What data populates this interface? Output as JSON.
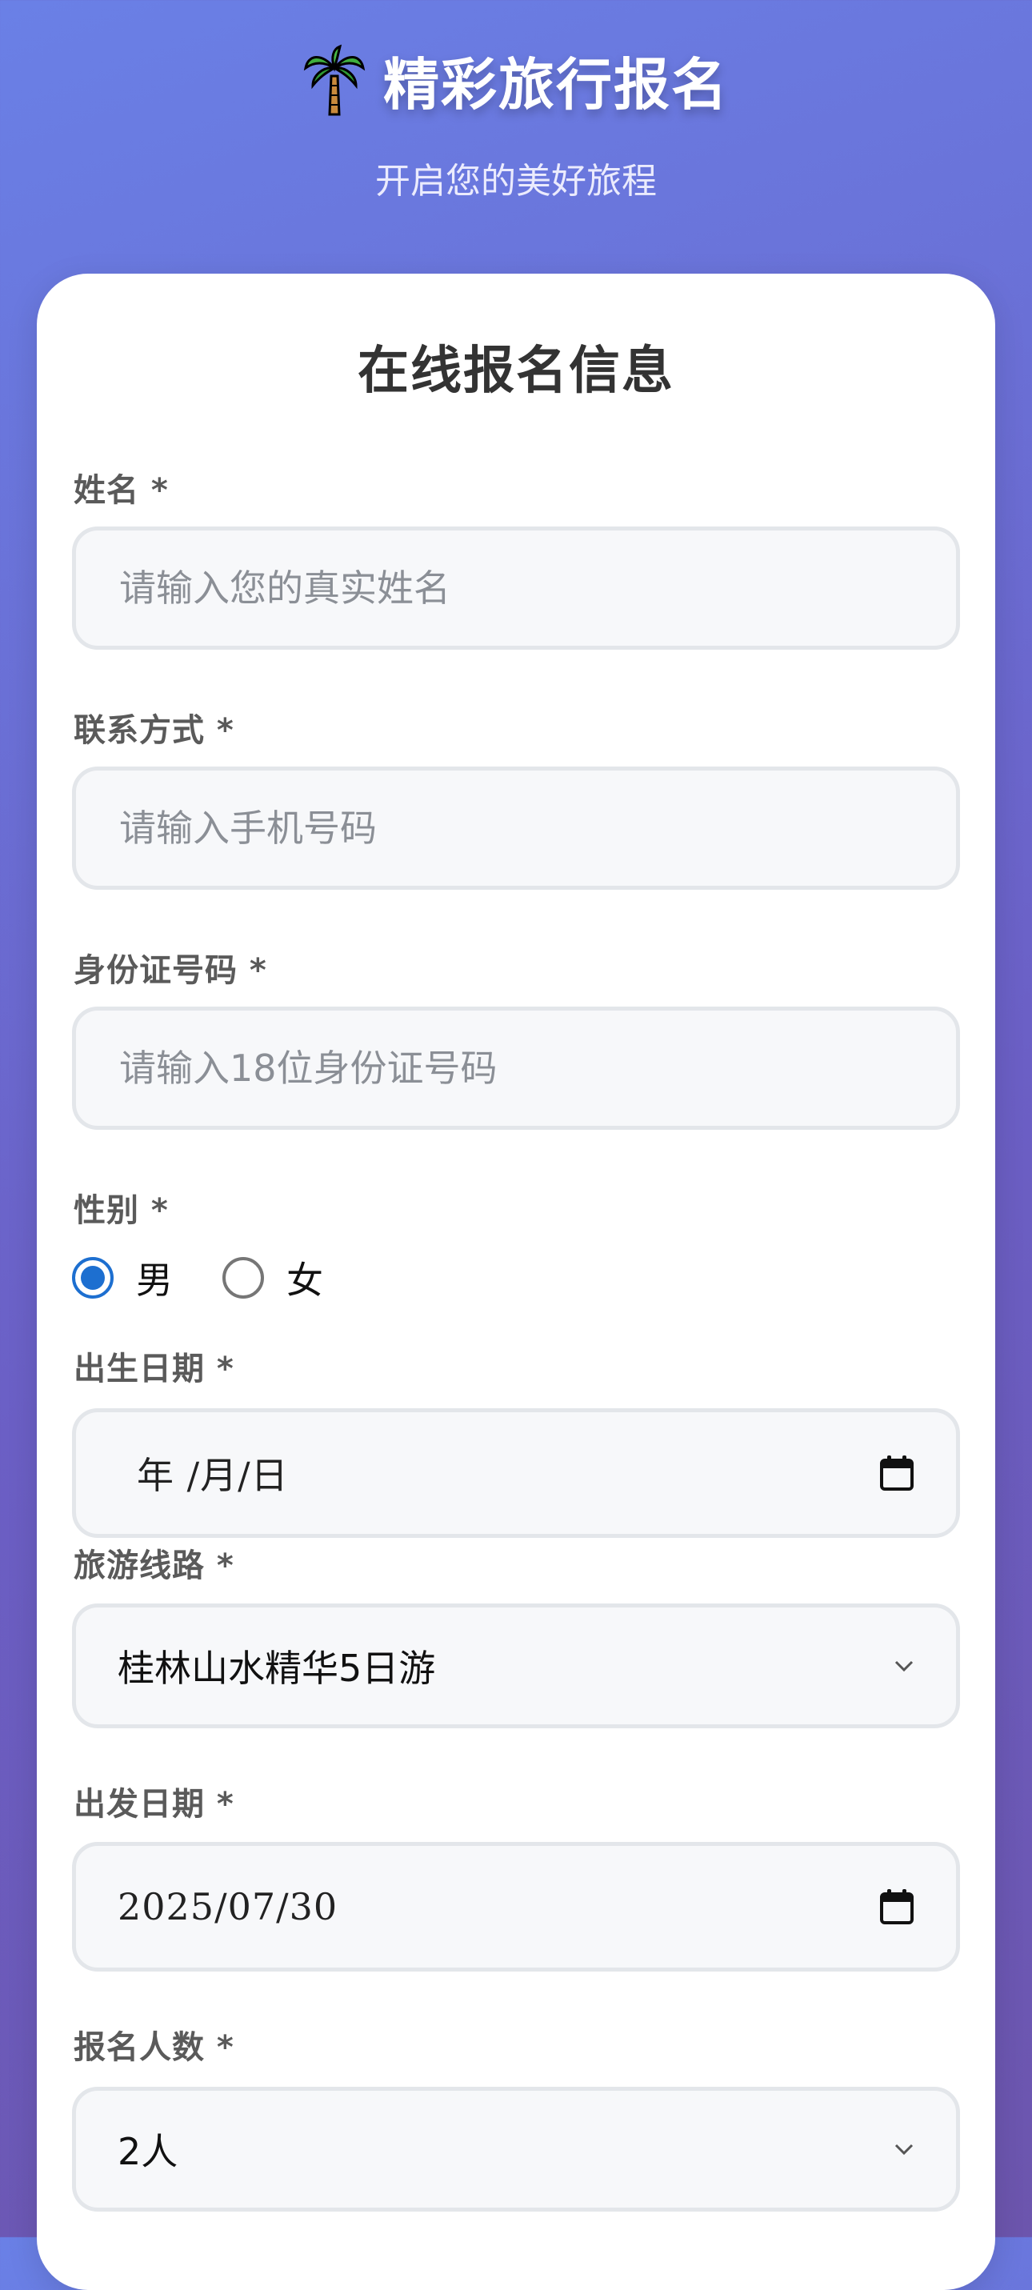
{
  "header": {
    "icon": "palm-tree-icon",
    "title": "精彩旅行报名",
    "subtitle": "开启您的美好旅程"
  },
  "form": {
    "title": "在线报名信息",
    "name": {
      "label": "姓名 *",
      "placeholder": "请输入您的真实姓名"
    },
    "phone": {
      "label": "联系方式 *",
      "placeholder": "请输入手机号码"
    },
    "id_number": {
      "label": "身份证号码 *",
      "placeholder": "请输入18位身份证号码"
    },
    "gender": {
      "label": "性别 *",
      "options": [
        "男",
        "女"
      ],
      "selected": "男"
    },
    "birth_date": {
      "label": "出生日期 *",
      "value": "年 /月/日"
    },
    "route": {
      "label": "旅游线路 *",
      "value": "桂林山水精华5日游"
    },
    "departure_date": {
      "label": "出发日期 *",
      "value": "2025/07/30"
    },
    "participants": {
      "label": "报名人数 *",
      "value": "2人"
    }
  },
  "colors": {
    "accent": "#1d6fd0",
    "background_start": "#6a80e6",
    "background_end": "#6c55ad"
  }
}
